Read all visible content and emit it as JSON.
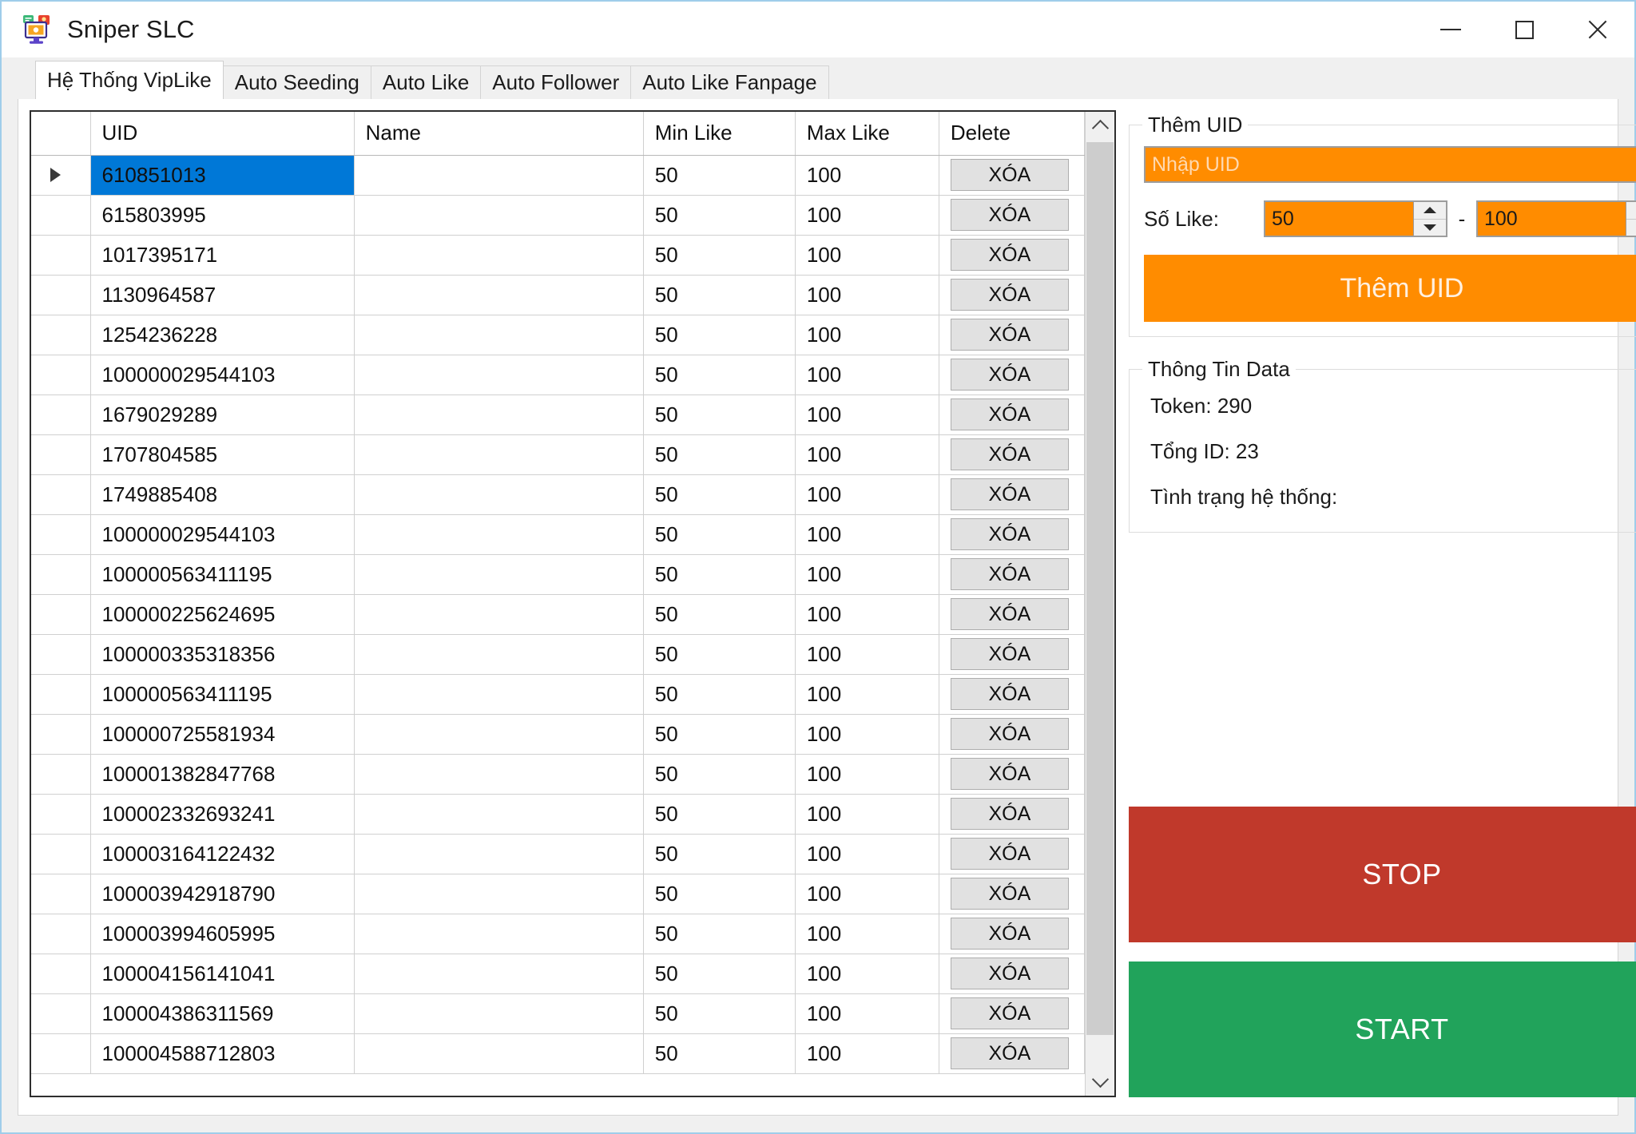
{
  "window": {
    "title": "Sniper SLC",
    "icon": "app-monitor-icon",
    "controls": {
      "minimize": "minimize-icon",
      "maximize": "maximize-icon",
      "close": "close-icon"
    }
  },
  "tabs": [
    {
      "label": "Hệ Thống VipLike",
      "active": true
    },
    {
      "label": "Auto Seeding",
      "active": false
    },
    {
      "label": "Auto Like",
      "active": false
    },
    {
      "label": "Auto Follower",
      "active": false
    },
    {
      "label": "Auto Like Fanpage",
      "active": false
    }
  ],
  "grid": {
    "columns": [
      "",
      "UID",
      "Name",
      "Min Like",
      "Max Like",
      "Delete"
    ],
    "delete_label": "XÓA",
    "selected_row_index": 0,
    "rows": [
      {
        "uid": "610851013",
        "name": "",
        "min_like": "50",
        "max_like": "100"
      },
      {
        "uid": "615803995",
        "name": "",
        "min_like": "50",
        "max_like": "100"
      },
      {
        "uid": "1017395171",
        "name": "",
        "min_like": "50",
        "max_like": "100"
      },
      {
        "uid": "1130964587",
        "name": "",
        "min_like": "50",
        "max_like": "100"
      },
      {
        "uid": "1254236228",
        "name": "",
        "min_like": "50",
        "max_like": "100"
      },
      {
        "uid": "100000029544103",
        "name": "",
        "min_like": "50",
        "max_like": "100"
      },
      {
        "uid": "1679029289",
        "name": "",
        "min_like": "50",
        "max_like": "100"
      },
      {
        "uid": "1707804585",
        "name": "",
        "min_like": "50",
        "max_like": "100"
      },
      {
        "uid": "1749885408",
        "name": "",
        "min_like": "50",
        "max_like": "100"
      },
      {
        "uid": "100000029544103",
        "name": "",
        "min_like": "50",
        "max_like": "100"
      },
      {
        "uid": "100000563411195",
        "name": "",
        "min_like": "50",
        "max_like": "100"
      },
      {
        "uid": "100000225624695",
        "name": "",
        "min_like": "50",
        "max_like": "100"
      },
      {
        "uid": "100000335318356",
        "name": "",
        "min_like": "50",
        "max_like": "100"
      },
      {
        "uid": "100000563411195",
        "name": "",
        "min_like": "50",
        "max_like": "100"
      },
      {
        "uid": "100000725581934",
        "name": "",
        "min_like": "50",
        "max_like": "100"
      },
      {
        "uid": "100001382847768",
        "name": "",
        "min_like": "50",
        "max_like": "100"
      },
      {
        "uid": "100002332693241",
        "name": "",
        "min_like": "50",
        "max_like": "100"
      },
      {
        "uid": "100003164122432",
        "name": "",
        "min_like": "50",
        "max_like": "100"
      },
      {
        "uid": "100003942918790",
        "name": "",
        "min_like": "50",
        "max_like": "100"
      },
      {
        "uid": "100003994605995",
        "name": "",
        "min_like": "50",
        "max_like": "100"
      },
      {
        "uid": "100004156141041",
        "name": "",
        "min_like": "50",
        "max_like": "100"
      },
      {
        "uid": "100004386311569",
        "name": "",
        "min_like": "50",
        "max_like": "100"
      },
      {
        "uid": "100004588712803",
        "name": "",
        "min_like": "50",
        "max_like": "100"
      }
    ],
    "scrollbar": {
      "up_arrow": "chevron-up-icon",
      "down_arrow": "chevron-down-icon"
    }
  },
  "panel": {
    "add_uid_group": {
      "title": "Thêm UID",
      "uid_input_placeholder": "Nhập UID",
      "uid_input_value": "",
      "so_like_label": "Số Like:",
      "min_value": "50",
      "max_value": "100",
      "separator": "-",
      "add_button_label": "Thêm UID"
    },
    "data_info_group": {
      "title": "Thông Tin Data",
      "lines": [
        "Token: 290",
        "Tổng ID: 23",
        "Tình trạng hệ thống:"
      ]
    },
    "actions": {
      "stop_label": "STOP",
      "start_label": "START"
    }
  },
  "colors": {
    "accent_orange": "#ff8c00",
    "stop_red": "#c0392b",
    "start_green": "#21a35b",
    "selection_blue": "#0078d7",
    "window_border": "#9fcdea"
  }
}
